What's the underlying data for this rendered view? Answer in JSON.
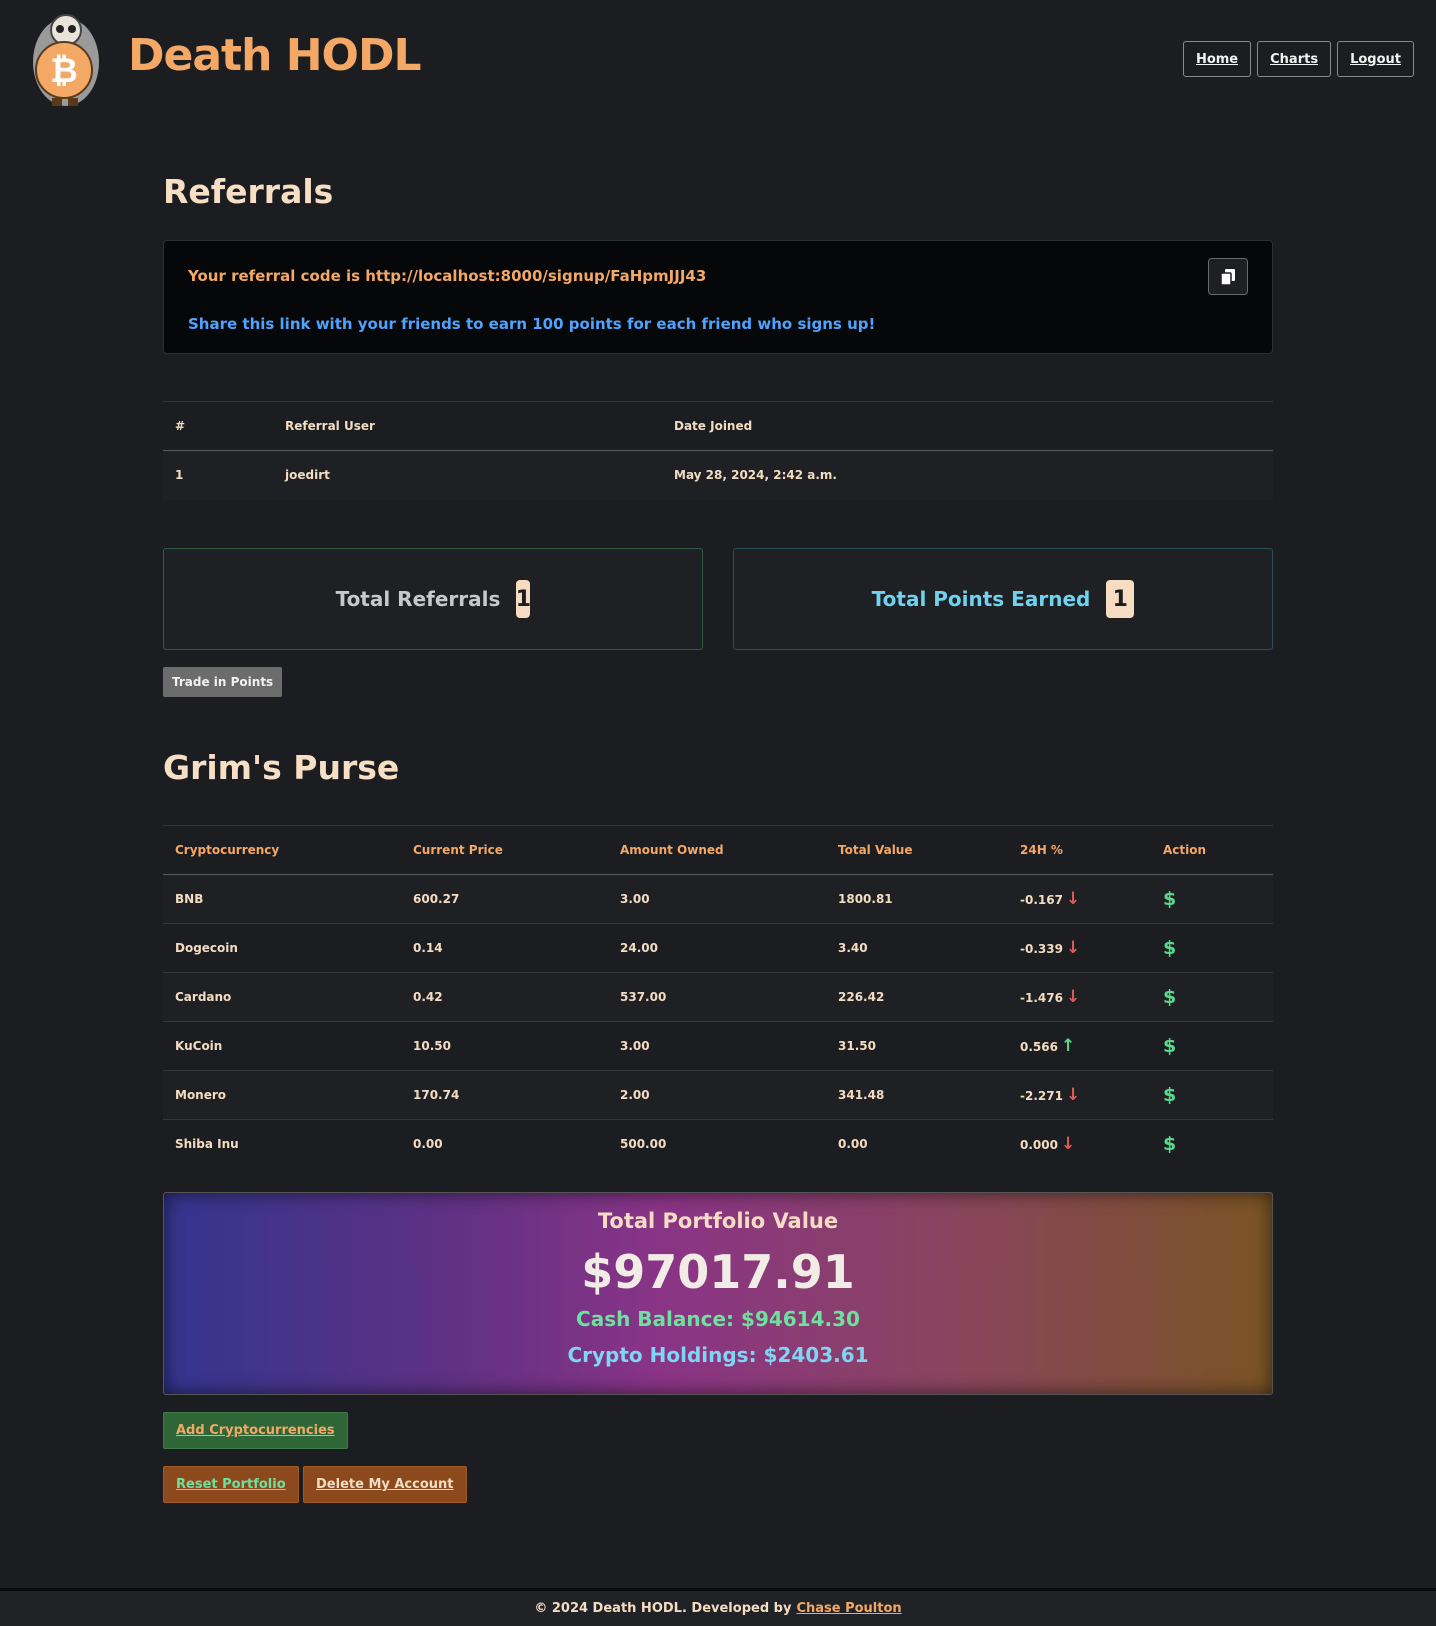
{
  "header": {
    "brand": "Death HODL",
    "nav": [
      "Home",
      "Charts",
      "Logout"
    ]
  },
  "referrals": {
    "heading": "Referrals",
    "code_text": "Your referral code is http://localhost:8000/signup/FaHpmJJJ43",
    "share_text": "Share this link with your friends to earn 100 points for each friend who signs up!",
    "table": {
      "headers": [
        "#",
        "Referral User",
        "Date Joined"
      ],
      "rows": [
        [
          "1",
          "joedirt",
          "May 28, 2024, 2:42 a.m."
        ]
      ]
    },
    "total_referrals_label": "Total Referrals",
    "total_referrals_value": "1",
    "total_points_label": "Total Points Earned",
    "total_points_value": "1",
    "trade_button": "Trade in Points"
  },
  "purse": {
    "heading": "Grim's Purse",
    "headers": [
      "Cryptocurrency",
      "Current Price",
      "Amount Owned",
      "Total Value",
      "24H %",
      "Action"
    ],
    "rows": [
      {
        "name": "BNB",
        "price": "600.27",
        "amount": "3.00",
        "total": "1800.81",
        "change": "-0.167",
        "direction": "down",
        "action": "$"
      },
      {
        "name": "Dogecoin",
        "price": "0.14",
        "amount": "24.00",
        "total": "3.40",
        "change": "-0.339",
        "direction": "down",
        "action": "$"
      },
      {
        "name": "Cardano",
        "price": "0.42",
        "amount": "537.00",
        "total": "226.42",
        "change": "-1.476",
        "direction": "down",
        "action": "$"
      },
      {
        "name": "KuCoin",
        "price": "10.50",
        "amount": "3.00",
        "total": "31.50",
        "change": "0.566",
        "direction": "up",
        "action": "$"
      },
      {
        "name": "Monero",
        "price": "170.74",
        "amount": "2.00",
        "total": "341.48",
        "change": "-2.271",
        "direction": "down",
        "action": "$"
      },
      {
        "name": "Shiba Inu",
        "price": "0.00",
        "amount": "500.00",
        "total": "0.00",
        "change": "0.000",
        "direction": "down",
        "action": "$"
      }
    ]
  },
  "portfolio": {
    "total_label": "Total Portfolio Value",
    "total_value": "$97017.91",
    "cash_balance": "Cash Balance: $94614.30",
    "crypto_holdings": "Crypto Holdings: $2403.61"
  },
  "actions": {
    "add": "Add Cryptocurrencies",
    "reset": "Reset Portfolio",
    "delete": "Delete My Account"
  },
  "footer": {
    "text": "© 2024 Death HODL. Developed by",
    "author": "Chase Poulton"
  },
  "colors": {
    "accent": "#f4a866",
    "background": "#1c1d20",
    "up": "#5ad98a",
    "down": "#e05a5a"
  }
}
